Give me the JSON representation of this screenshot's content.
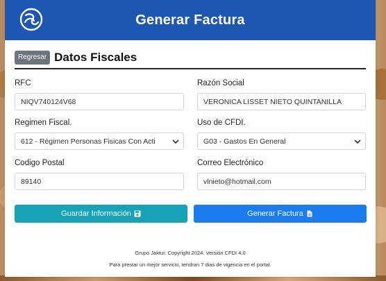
{
  "header": {
    "title": "Generar Factura",
    "logo_icon": "swirl-logo-icon"
  },
  "section": {
    "back_label": "Regresar",
    "title": "Datos Fiscales"
  },
  "form": {
    "rfc": {
      "label": "RFC",
      "value": "NIQV740124V68"
    },
    "razon_social": {
      "label": "Razón Social",
      "value": "VERONICA LISSET NIETO QUINTANILLA"
    },
    "regimen_fiscal": {
      "label": "Regimen Fiscal.",
      "value": "612 - Régimen Personas Fisicas Con Acti"
    },
    "uso_cfdi": {
      "label": "Uso de CFDI.",
      "value": "G03 - Gastos En General"
    },
    "codigo_postal": {
      "label": "Codigo Postal",
      "value": "89140"
    },
    "correo": {
      "label": "Correo Electrónico",
      "value": "vlnieto@hotmail.com"
    }
  },
  "actions": {
    "save_label": "Guardar Información",
    "save_icon": "floppy-disk-icon",
    "generate_label": "Generar Factura",
    "generate_icon": "document-icon"
  },
  "footer": {
    "line1": "Grupo Jaktur. Copyright 2024. Versión CFDI 4.0",
    "line2": "Para prestar un mejor servicio, tendran 7 dias de vigencia en el portal."
  },
  "colors": {
    "header": "#1d57b4",
    "save_button": "#17a2b8",
    "generate_button": "#1a7cf0",
    "back_button": "#6c757d"
  }
}
